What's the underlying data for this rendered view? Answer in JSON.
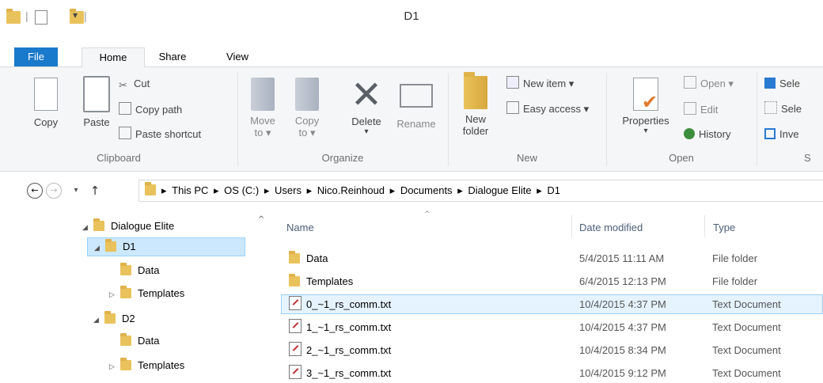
{
  "window": {
    "title": "D1"
  },
  "tabs": {
    "file": "File",
    "home": "Home",
    "share": "Share",
    "view": "View"
  },
  "ribbon": {
    "clipboard": {
      "copy": "Copy",
      "paste": "Paste",
      "cut": "Cut",
      "copy_path": "Copy path",
      "paste_shortcut": "Paste shortcut",
      "group": "Clipboard"
    },
    "organize": {
      "move_to": "Move",
      "move_to_2": "to ▾",
      "copy_to": "Copy",
      "copy_to_2": "to ▾",
      "delete": "Delete",
      "delete_arrow": "▾",
      "rename": "Rename",
      "group": "Organize"
    },
    "new": {
      "new_folder": "New",
      "new_folder_2": "folder",
      "new_item": "New item ▾",
      "easy_access": "Easy access ▾",
      "group": "New"
    },
    "open": {
      "properties": "Properties",
      "properties_arrow": "▾",
      "open": "Open ▾",
      "edit": "Edit",
      "history": "History",
      "group": "Open"
    },
    "select": {
      "select_all": "Sele",
      "select_none": "Sele",
      "invert": "Inve",
      "group": "S"
    }
  },
  "address": {
    "crumbs": [
      "This PC",
      "OS (C:)",
      "Users",
      "Nico.Reinhoud",
      "Documents",
      "Dialogue Elite",
      "D1"
    ],
    "separator": "▸"
  },
  "nav_tree": [
    {
      "label": "Dialogue Elite",
      "expander": "◢"
    },
    {
      "label": "D1",
      "expander": "◢"
    },
    {
      "label": "Data",
      "expander": ""
    },
    {
      "label": "Templates",
      "expander": "▷"
    },
    {
      "label": "D2",
      "expander": "◢"
    },
    {
      "label": "Data",
      "expander": ""
    },
    {
      "label": "Templates",
      "expander": "▷"
    }
  ],
  "columns": {
    "name": "Name",
    "date": "Date modified",
    "type": "Type"
  },
  "files": [
    {
      "name": "Data",
      "date": "5/4/2015 11:11 AM",
      "type": "File folder",
      "kind": "folder"
    },
    {
      "name": "Templates",
      "date": "6/4/2015 12:13 PM",
      "type": "File folder",
      "kind": "folder"
    },
    {
      "name": "0_~1_rs_comm.txt",
      "date": "10/4/2015 4:37 PM",
      "type": "Text Document",
      "kind": "text"
    },
    {
      "name": "1_~1_rs_comm.txt",
      "date": "10/4/2015 4:37 PM",
      "type": "Text Document",
      "kind": "text"
    },
    {
      "name": "2_~1_rs_comm.txt",
      "date": "10/4/2015 8:34 PM",
      "type": "Text Document",
      "kind": "text"
    },
    {
      "name": "3_~1_rs_comm.txt",
      "date": "10/4/2015 9:12 PM",
      "type": "Text Document",
      "kind": "text"
    }
  ],
  "colors": {
    "accent": "#1979ca",
    "selection": "#e5f3ff",
    "selection_border": "#99d1ff",
    "folder": "#e9c25b"
  }
}
